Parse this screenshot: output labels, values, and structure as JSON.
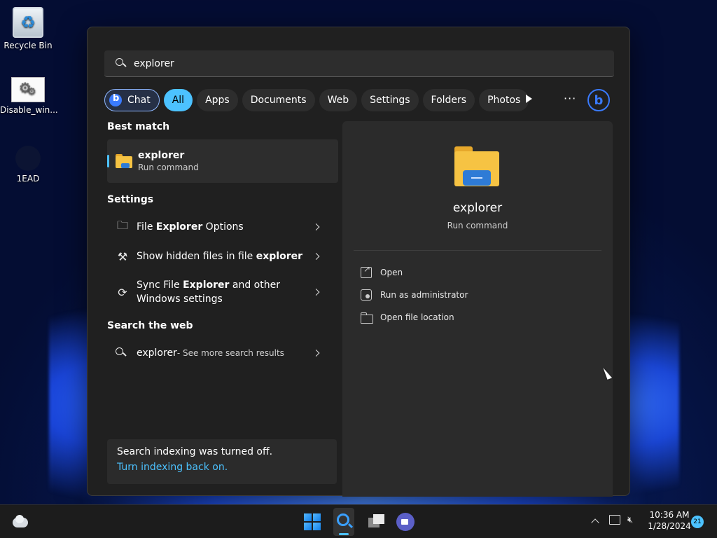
{
  "desktop": {
    "icons": [
      {
        "label": "Recycle Bin",
        "icon": "recycle-bin-icon"
      },
      {
        "label": "Disable_win...",
        "icon": "settings-shortcut-icon"
      },
      {
        "label": "1EAD",
        "icon": "dark-app-icon"
      }
    ]
  },
  "search": {
    "query": "explorer",
    "filters": [
      {
        "label": "Chat",
        "icon": "bing-icon"
      },
      {
        "label": "All",
        "active": true
      },
      {
        "label": "Apps"
      },
      {
        "label": "Documents"
      },
      {
        "label": "Web"
      },
      {
        "label": "Settings"
      },
      {
        "label": "Folders"
      },
      {
        "label": "Photos"
      }
    ],
    "more_label": "···"
  },
  "results": {
    "best_match_title": "Best match",
    "best_match": {
      "name": "explorer",
      "type": "Run command",
      "icon": "file-explorer-icon"
    },
    "settings_title": "Settings",
    "settings_items": [
      {
        "pre": "File ",
        "bold": "Explorer",
        "post": " Options",
        "icon": "folder-options-icon"
      },
      {
        "pre": "Show hidden files in file ",
        "bold": "explorer",
        "post": "",
        "icon": "tools-icon"
      },
      {
        "pre": "Sync File ",
        "bold": "Explorer",
        "post": " and other Windows settings",
        "icon": "sync-icon"
      }
    ],
    "web_title": "Search the web",
    "web_item": {
      "query": "explorer",
      "suffix": " - See more search results"
    }
  },
  "indexing": {
    "message": "Search indexing was turned off.",
    "link": "Turn indexing back on."
  },
  "preview": {
    "name": "explorer",
    "type": "Run command",
    "actions": [
      {
        "label": "Open",
        "icon": "open-icon"
      },
      {
        "label": "Run as administrator",
        "icon": "admin-shield-icon"
      },
      {
        "label": "Open file location",
        "icon": "folder-location-icon"
      }
    ]
  },
  "taskbar": {
    "time": "10:36 AM",
    "date": "1/28/2024",
    "notification_count": "21"
  },
  "colors": {
    "accent": "#4cc2ff",
    "panel_bg": "#202020",
    "folder_yellow": "#f6c343",
    "folder_blue": "#2e7bd6"
  }
}
